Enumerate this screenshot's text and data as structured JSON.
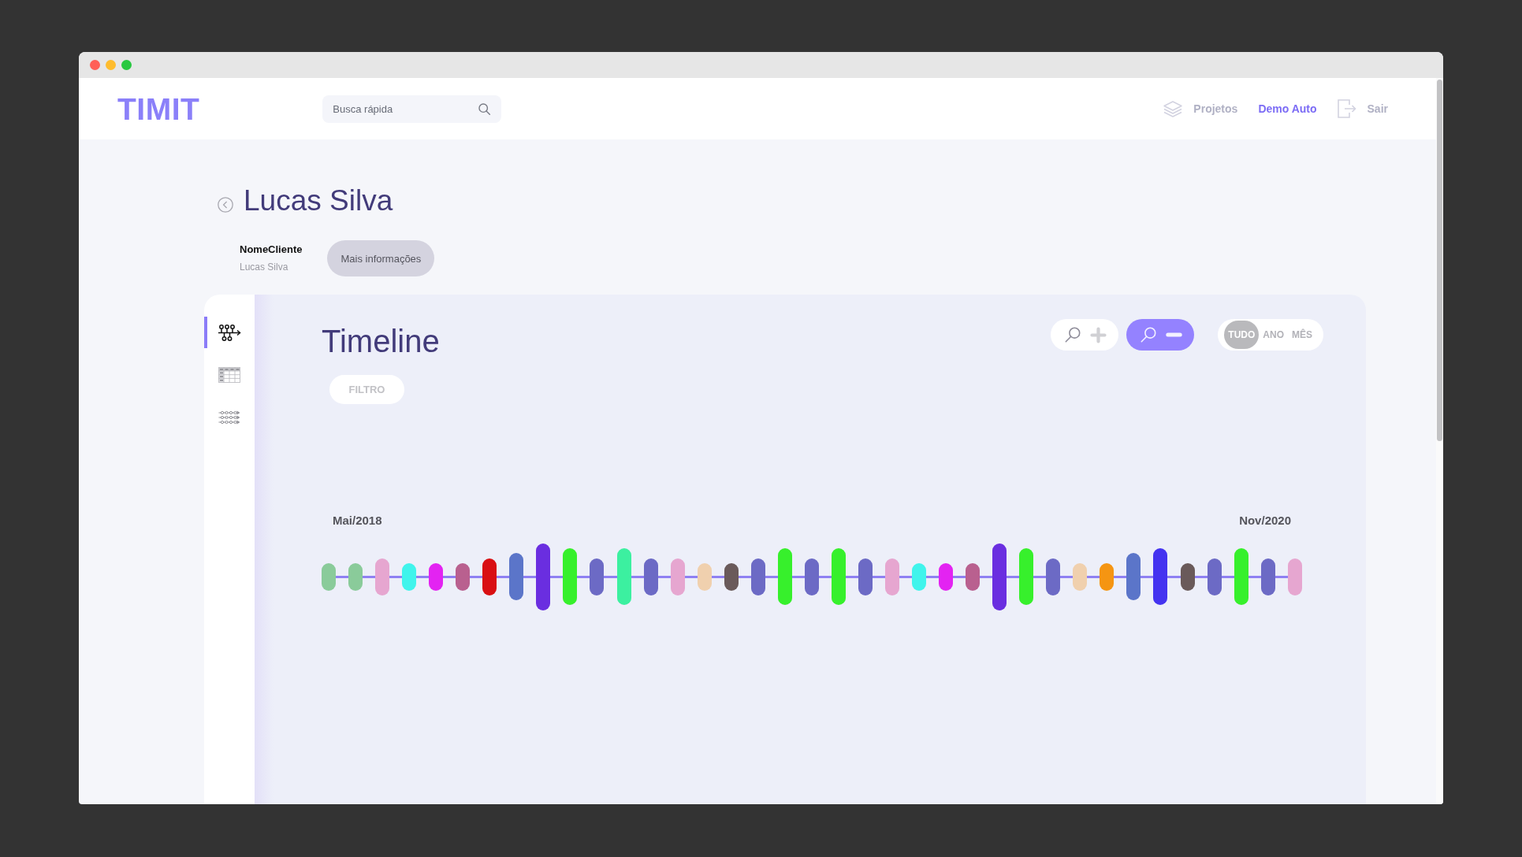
{
  "window": {
    "buttons": [
      {
        "color": "#ff5f57"
      },
      {
        "color": "#febc2e"
      },
      {
        "color": "#28c840"
      }
    ]
  },
  "header": {
    "logo": "TIMIT",
    "search": {
      "placeholder": "Busca rápida"
    },
    "nav": [
      {
        "kind": "projects",
        "label": "Projetos",
        "selected": false
      },
      {
        "kind": "user",
        "label": "Demo Auto",
        "selected": true
      },
      {
        "kind": "logout",
        "label": "Sair",
        "selected": false
      }
    ]
  },
  "page": {
    "title": "Lucas Silva",
    "fields": [
      {
        "label": "NomeCliente",
        "value": "Lucas Silva"
      }
    ],
    "more_button": "Mais informações"
  },
  "card": {
    "sidebar": [
      {
        "kind": "timeline",
        "selected": true
      },
      {
        "kind": "table",
        "selected": false
      },
      {
        "kind": "flows",
        "selected": false
      }
    ],
    "title": "Timeline",
    "filter_button": "FILTRO",
    "zoom_buttons": [
      {
        "kind": "zoom-in",
        "active": false
      },
      {
        "kind": "zoom-out",
        "active": true
      }
    ],
    "range_tabs": [
      {
        "label": "TUDO",
        "selected": true
      },
      {
        "label": "ANO",
        "selected": false
      },
      {
        "label": "MÊS",
        "selected": false
      }
    ],
    "timeline": {
      "start_label": "Mai/2018",
      "end_label": "Nov/2020",
      "events": [
        {
          "color": "#8acb9a",
          "kind": "small"
        },
        {
          "color": "#8acb9a",
          "kind": "small"
        },
        {
          "color": "#e6a6d0",
          "kind": "medium"
        },
        {
          "color": "#40f4ec",
          "kind": "small"
        },
        {
          "color": "#e323f2",
          "kind": "small"
        },
        {
          "color": "#b9608f",
          "kind": "small"
        },
        {
          "color": "#d90f12",
          "kind": "medium"
        },
        {
          "color": "#5b75c9",
          "kind": "large"
        },
        {
          "color": "#6a2ee0",
          "kind": "xxlarge"
        },
        {
          "color": "#37f02c",
          "kind": "xlarge"
        },
        {
          "color": "#6c6ac5",
          "kind": "medium"
        },
        {
          "color": "#3cf0a0",
          "kind": "xlarge"
        },
        {
          "color": "#6c6ac5",
          "kind": "medium"
        },
        {
          "color": "#e6a6d0",
          "kind": "medium"
        },
        {
          "color": "#f0d0ae",
          "kind": "small"
        },
        {
          "color": "#6a5a5a",
          "kind": "small"
        },
        {
          "color": "#6c6ac5",
          "kind": "medium"
        },
        {
          "color": "#37f02c",
          "kind": "xlarge"
        },
        {
          "color": "#6c6ac5",
          "kind": "medium"
        },
        {
          "color": "#37f02c",
          "kind": "xlarge"
        },
        {
          "color": "#6c6ac5",
          "kind": "medium"
        },
        {
          "color": "#e6a6d0",
          "kind": "medium"
        },
        {
          "color": "#40f4ec",
          "kind": "small"
        },
        {
          "color": "#e323f2",
          "kind": "small"
        },
        {
          "color": "#b9608f",
          "kind": "small"
        },
        {
          "color": "#6a2ee0",
          "kind": "xxlarge"
        },
        {
          "color": "#37f02c",
          "kind": "xlarge"
        },
        {
          "color": "#6c6ac5",
          "kind": "medium"
        },
        {
          "color": "#f0d0ae",
          "kind": "small"
        },
        {
          "color": "#f59512",
          "kind": "small"
        },
        {
          "color": "#5b75c9",
          "kind": "large"
        },
        {
          "color": "#4433f0",
          "kind": "xlarge"
        },
        {
          "color": "#6a5a5a",
          "kind": "small"
        },
        {
          "color": "#6c6ac5",
          "kind": "medium"
        },
        {
          "color": "#37f02c",
          "kind": "xlarge"
        },
        {
          "color": "#6c6ac5",
          "kind": "medium"
        },
        {
          "color": "#e6a6d0",
          "kind": "medium"
        }
      ]
    }
  }
}
